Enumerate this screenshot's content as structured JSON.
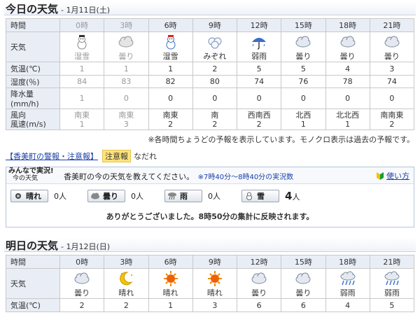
{
  "today": {
    "title": "今日の天気",
    "date": "- 1月11日(土)",
    "hours_label": "時間",
    "hours": [
      {
        "time": "0時",
        "past": true
      },
      {
        "time": "3時",
        "past": true
      },
      {
        "time": "6時",
        "past": false
      },
      {
        "time": "9時",
        "past": false
      },
      {
        "time": "12時",
        "past": false
      },
      {
        "time": "15時",
        "past": false
      },
      {
        "time": "18時",
        "past": false
      },
      {
        "time": "21時",
        "past": false
      }
    ],
    "weather_label": "天気",
    "weather": [
      {
        "label": "湿雪",
        "icon": "wet-snow-icon"
      },
      {
        "label": "曇り",
        "icon": "cloudy-icon"
      },
      {
        "label": "湿雪",
        "icon": "wet-snow-icon"
      },
      {
        "label": "みぞれ",
        "icon": "sleet-icon"
      },
      {
        "label": "弱雨",
        "icon": "umbrella-rain-icon"
      },
      {
        "label": "曇り",
        "icon": "cloudy-icon"
      },
      {
        "label": "曇り",
        "icon": "cloudy-icon"
      },
      {
        "label": "曇り",
        "icon": "cloudy-icon"
      }
    ],
    "temp_label": "気温(℃)",
    "temp": [
      "1",
      "1",
      "1",
      "2",
      "5",
      "5",
      "4",
      "3"
    ],
    "humidity_label": "湿度(％)",
    "humidity": [
      "84",
      "83",
      "82",
      "80",
      "74",
      "76",
      "78",
      "74"
    ],
    "precip_label": "降水量(mm/h)",
    "precip": [
      "1",
      "0",
      "0",
      "0",
      "0",
      "0",
      "0",
      "0"
    ],
    "wind_dir_label": "風向",
    "wind_speed_label": "風速(m/s)",
    "wind_dir": [
      "南東",
      "南東",
      "南東",
      "南",
      "西南西",
      "北西",
      "北北西",
      "南南東"
    ],
    "wind_speed": [
      "1",
      "3",
      "2",
      "2",
      "2",
      "1",
      "1",
      "2"
    ]
  },
  "note": "※各時間ちょうどの予報を表示しています。モノクロ表示は過去の予報です。",
  "warning": {
    "link": "【香美町の警報・注意報】",
    "badge": "注意報",
    "item": "なだれ"
  },
  "report": {
    "minna_line1": "みんなで実況!",
    "minna_line2": "今の天気",
    "question": "香美町の今の天気を教えてください。",
    "question_note": "※7時40分～8時40分の実況数",
    "howto": "使い方",
    "votes": [
      {
        "label": "晴れ",
        "count": "0",
        "unit": "人",
        "icon": "sun-icon",
        "big": false
      },
      {
        "label": "曇り",
        "count": "0",
        "unit": "人",
        "icon": "cloud-icon",
        "big": false
      },
      {
        "label": "雨",
        "count": "0",
        "unit": "人",
        "icon": "rain-icon",
        "big": false
      },
      {
        "label": "雪",
        "count": "4",
        "unit": "人",
        "icon": "snowman-icon",
        "big": true
      }
    ],
    "thanks": "ありがとうございました。8時50分の集計に反映されます。"
  },
  "tomorrow": {
    "title": "明日の天気",
    "date": "- 1月12日(日)",
    "hours_label": "時間",
    "hours": [
      "0時",
      "3時",
      "6時",
      "9時",
      "12時",
      "15時",
      "18時",
      "21時"
    ],
    "weather_label": "天気",
    "weather": [
      {
        "label": "曇り",
        "icon": "cloudy-icon"
      },
      {
        "label": "晴れ",
        "icon": "moon-icon"
      },
      {
        "label": "晴れ",
        "icon": "sun-icon"
      },
      {
        "label": "晴れ",
        "icon": "sun-icon"
      },
      {
        "label": "曇り",
        "icon": "cloudy-icon"
      },
      {
        "label": "曇り",
        "icon": "cloudy-icon"
      },
      {
        "label": "弱雨",
        "icon": "rain-icon"
      },
      {
        "label": "弱雨",
        "icon": "rain-icon"
      }
    ],
    "temp_label": "気温(℃)",
    "temp": [
      "2",
      "2",
      "1",
      "3",
      "6",
      "6",
      "4",
      "5"
    ]
  },
  "colors": {
    "accent": "#1a3fa8",
    "header_bg": "#e9eef6",
    "badge": "#ffe37a",
    "sun": "#f06000",
    "rain": "#3a6ec8"
  }
}
